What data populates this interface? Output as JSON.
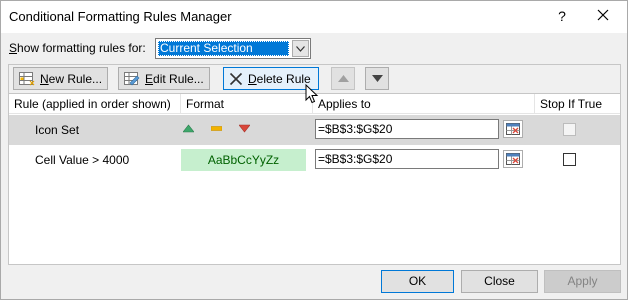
{
  "window": {
    "title": "Conditional Formatting Rules Manager",
    "help": "?",
    "close_icon": "close-icon"
  },
  "scope": {
    "label_hotkey": "S",
    "label_rest": "how formatting rules for:",
    "selected": "Current Selection"
  },
  "toolbar": {
    "new_hotkey": "N",
    "new_rest": "ew Rule...",
    "edit_hotkey": "E",
    "edit_rest": "dit Rule...",
    "delete_hotkey": "D",
    "delete_rest": "elete Rule",
    "move_up_icon": "triangle-up-icon",
    "move_down_icon": "triangle-down-icon"
  },
  "columns": {
    "rule": "Rule (applied in order shown)",
    "format": "Format",
    "applies": "Applies to",
    "stop": "Stop If True"
  },
  "rules": [
    {
      "name": "Icon Set",
      "format_icons": [
        "green-up-triangle-icon",
        "yellow-dash-icon",
        "red-down-triangle-icon"
      ],
      "applies_to": "=$B$3:$G$20",
      "stop_if_true": false,
      "selected": true
    },
    {
      "name": "Cell Value > 4000",
      "format_preview": "AaBbCcYyZz",
      "applies_to": "=$B$3:$G$20",
      "stop_if_true": false,
      "selected": false
    }
  ],
  "footer": {
    "ok": "OK",
    "close": "Close",
    "apply": "Apply"
  },
  "colors": {
    "selection": "#0078d7",
    "preview_fill": "#c6efce",
    "preview_text": "#006100",
    "icon_green": "#3ea76b",
    "icon_yellow": "#f2b300",
    "icon_red": "#d9473a"
  }
}
